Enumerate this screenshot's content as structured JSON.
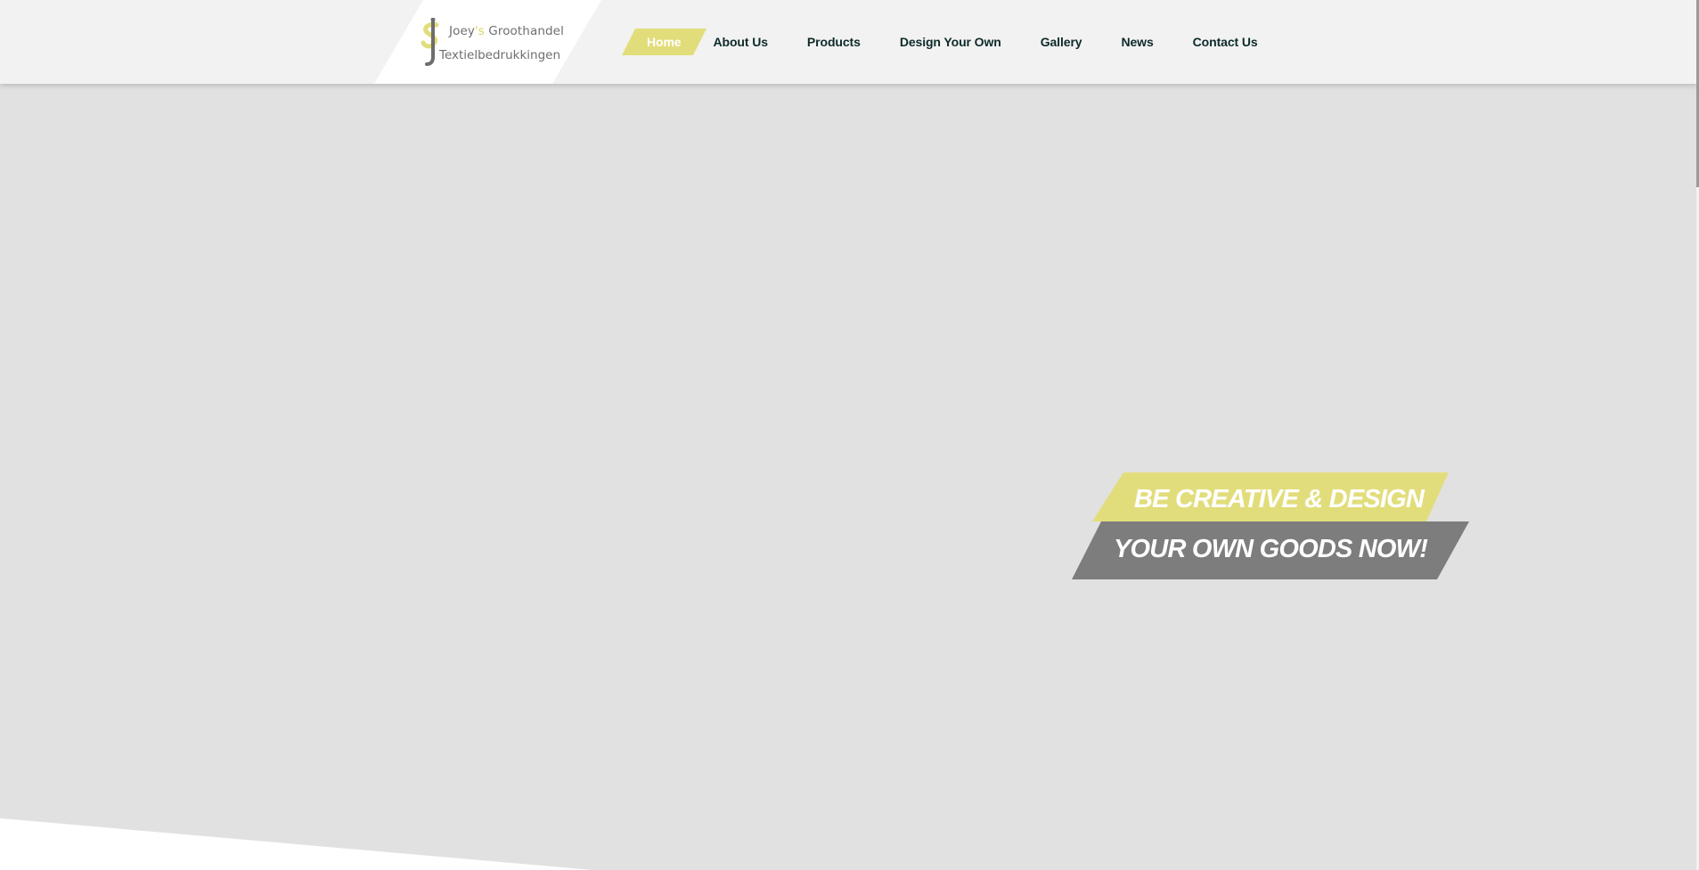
{
  "header": {
    "logo": {
      "line1_name": "Joey",
      "line1_apos": "'s",
      "line1_rest": " Groothandel",
      "line2": "Textielbedrukkingen"
    },
    "nav": [
      {
        "label": "Home",
        "active": true
      },
      {
        "label": "About Us",
        "active": false
      },
      {
        "label": "Products",
        "active": false
      },
      {
        "label": "Design Your Own",
        "active": false
      },
      {
        "label": "Gallery",
        "active": false
      },
      {
        "label": "News",
        "active": false
      },
      {
        "label": "Contact Us",
        "active": false
      }
    ]
  },
  "hero": {
    "line1": "BE CREATIVE & DESIGN",
    "line2": "YOUR OWN GOODS NOW!"
  },
  "colors": {
    "accent_yellow": "#e2dd7b",
    "banner_gray": "#7d7d7d",
    "header_bg": "#f2f2f2",
    "page_bg": "#e1e1e1",
    "nav_text": "#0e2a2a"
  },
  "icons": {
    "logo_mark": "joeys-logo-icon"
  }
}
